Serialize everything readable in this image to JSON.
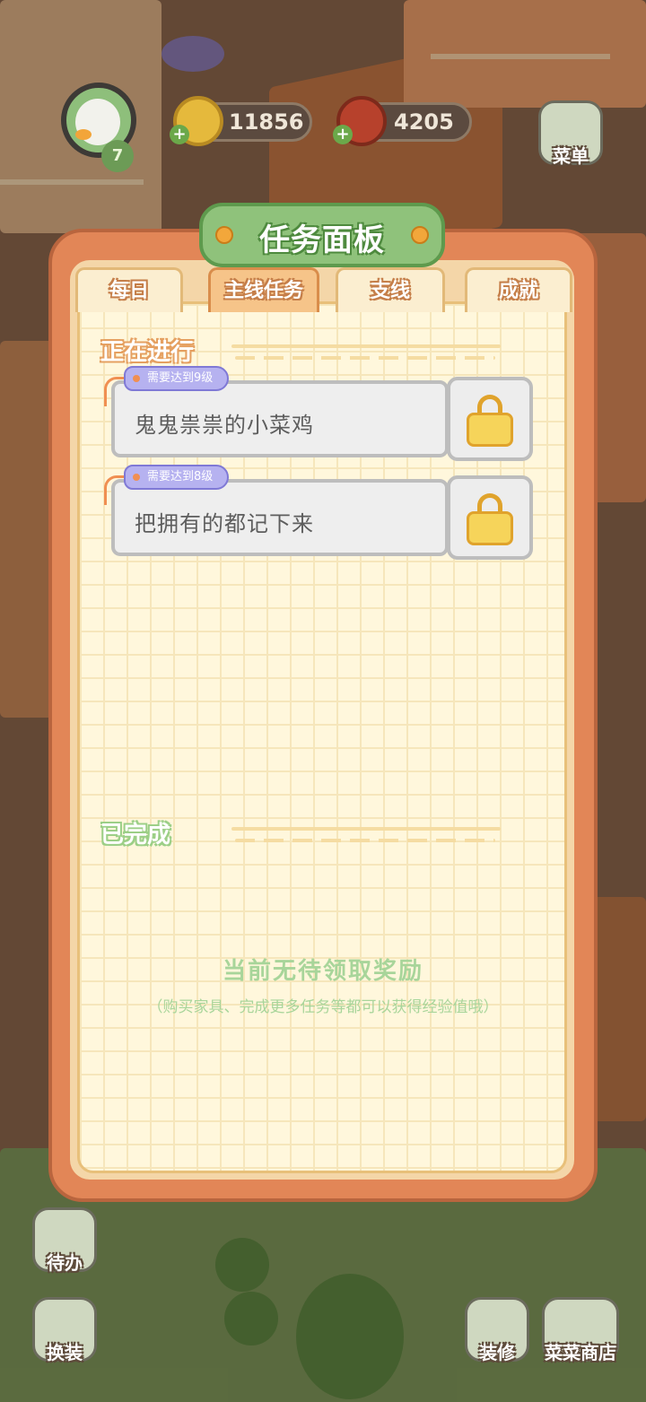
{
  "hud": {
    "player_level": "7",
    "coins": "11856",
    "meat": "4205",
    "menu_label": "菜单"
  },
  "panel": {
    "title": "任务面板",
    "tabs": [
      {
        "label": "每日",
        "active": false
      },
      {
        "label": "主线任务",
        "active": true
      },
      {
        "label": "支线",
        "active": false
      },
      {
        "label": "成就",
        "active": false
      }
    ],
    "in_progress_label": "正在进行",
    "completed_label": "已完成",
    "tasks": [
      {
        "requirement": "需要达到9级",
        "title": "鬼鬼祟祟的小菜鸡",
        "locked": true
      },
      {
        "requirement": "需要达到8级",
        "title": "把拥有的都记下来",
        "locked": true
      }
    ],
    "empty_title": "当前无待领取奖励",
    "empty_subtitle": "（购买家具、完成更多任务等都可以获得经验值哦）"
  },
  "bottom_buttons": {
    "todo": "待办",
    "skin": "换装",
    "decorate": "装修",
    "shop": "菜菜商店"
  }
}
